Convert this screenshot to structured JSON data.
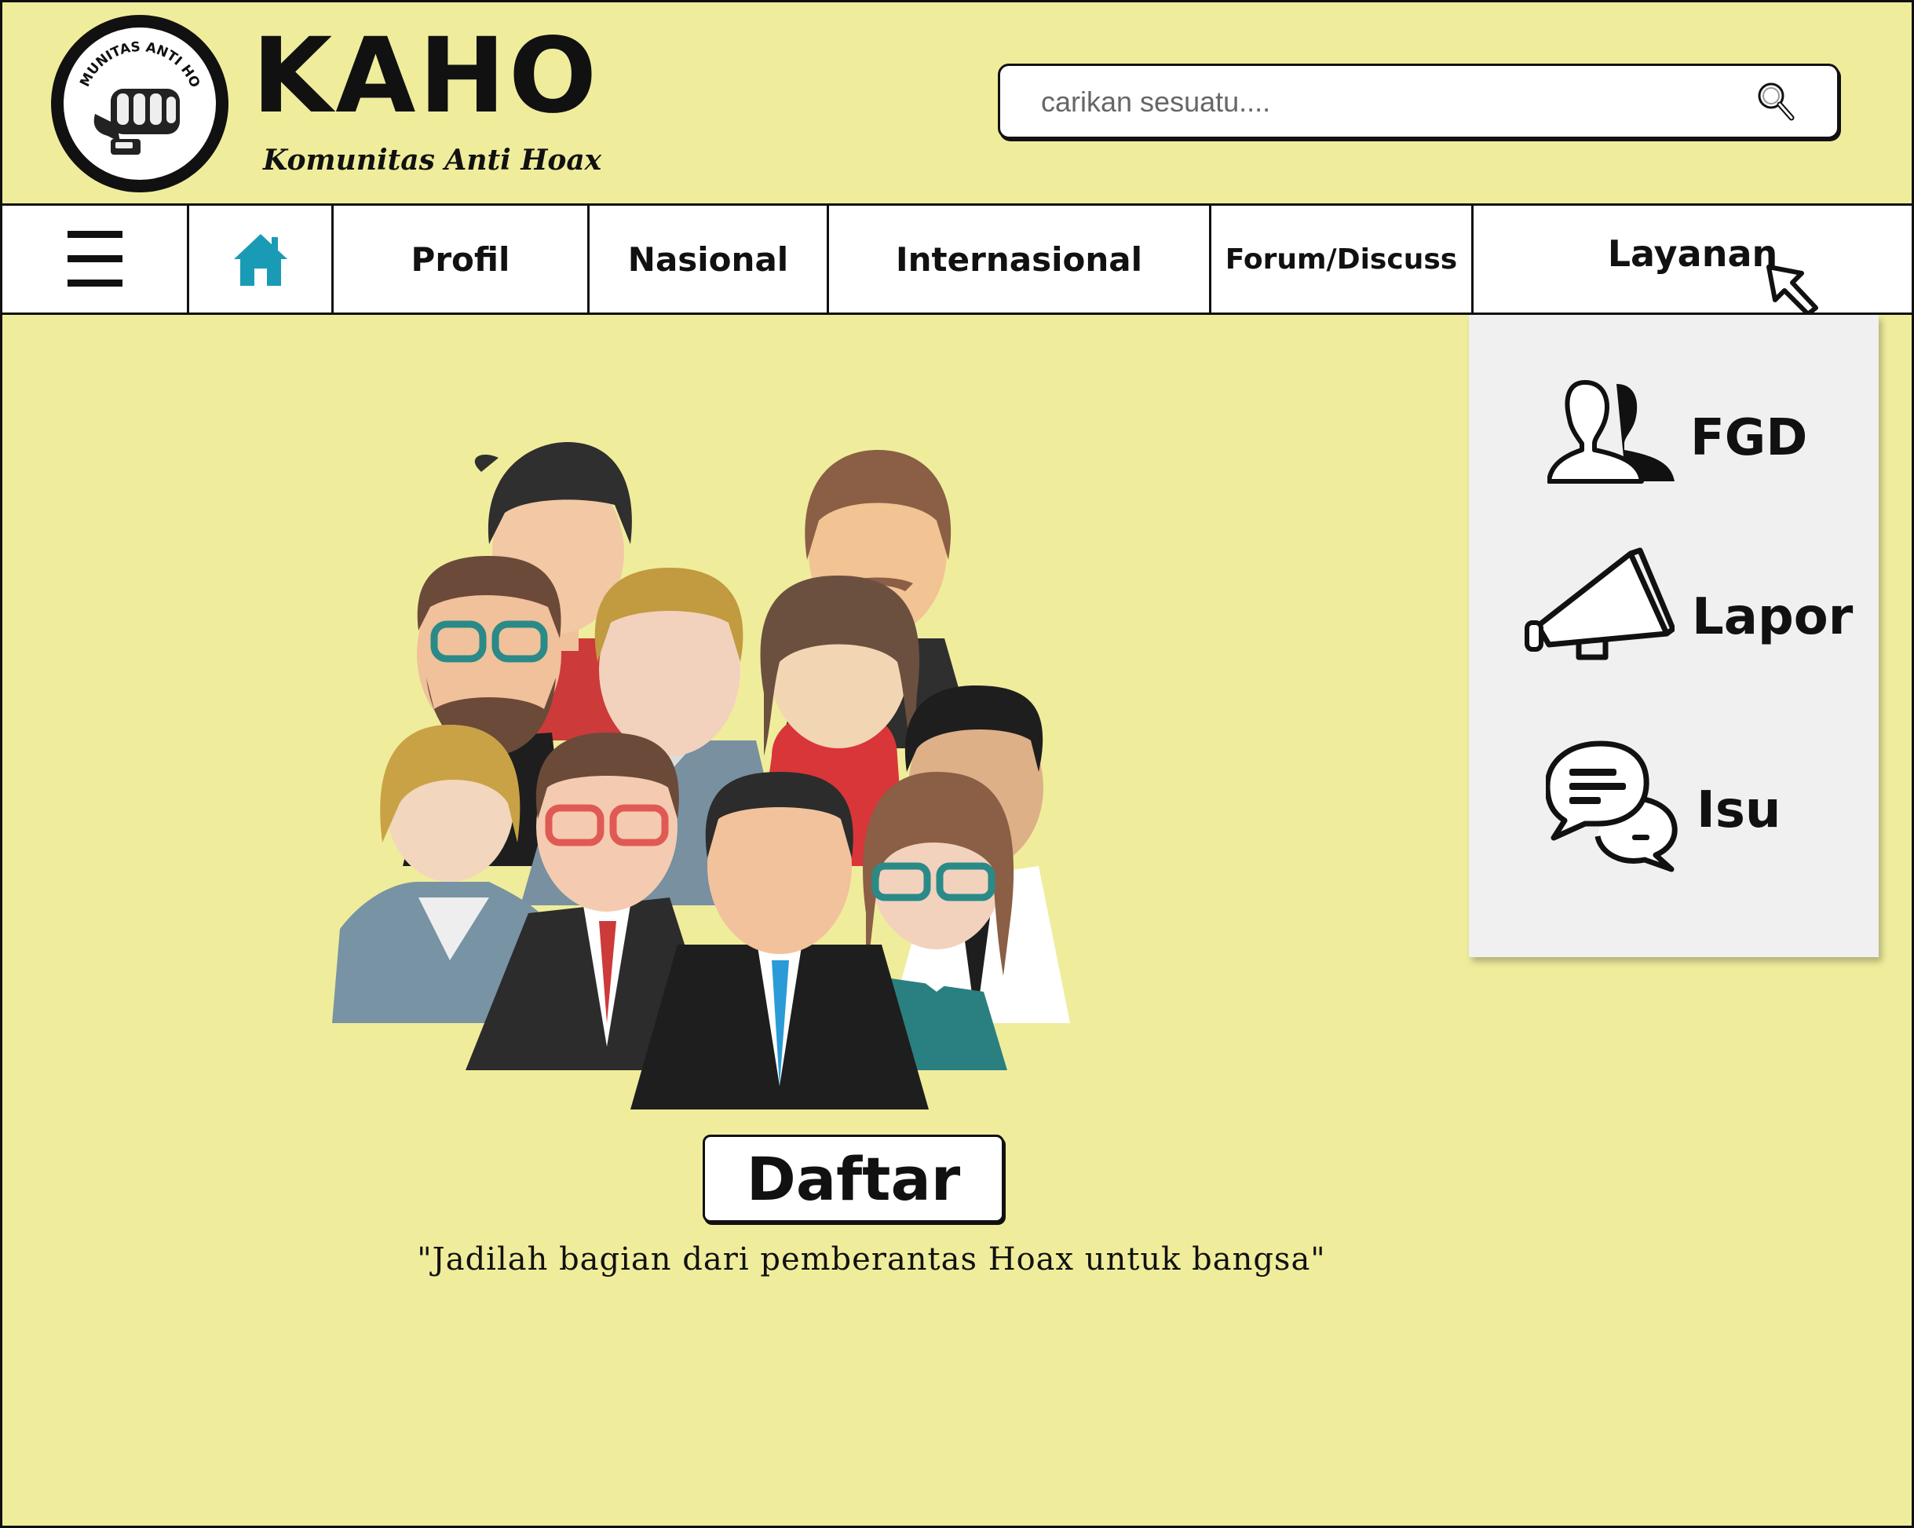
{
  "brand": {
    "name": "KAHO",
    "tagline": "Komunitas Anti Hoax",
    "badge_text": "KOMUNITAS ANTI HOAX"
  },
  "search": {
    "placeholder": "carikan sesuatu...."
  },
  "nav": {
    "menu_icon": "hamburger-icon",
    "home_icon": "home-icon",
    "items": [
      "Profil",
      "Nasional",
      "Internasional",
      "Forum/Discuss",
      "Layanan"
    ]
  },
  "dropdown": {
    "items": [
      {
        "label": "FGD",
        "icon": "users-icon"
      },
      {
        "label": "Lapor",
        "icon": "megaphone-icon"
      },
      {
        "label": "Isu",
        "icon": "chat-bubbles-icon"
      }
    ]
  },
  "hero": {
    "illustration": "people-group-illustration"
  },
  "cta": {
    "label": "Daftar"
  },
  "slogan": "\"Jadilah bagian dari pemberantas Hoax untuk bangsa\"",
  "colors": {
    "background": "#efed9c",
    "home_icon": "#1a9bb5",
    "dropdown": "#f0f0f0"
  }
}
